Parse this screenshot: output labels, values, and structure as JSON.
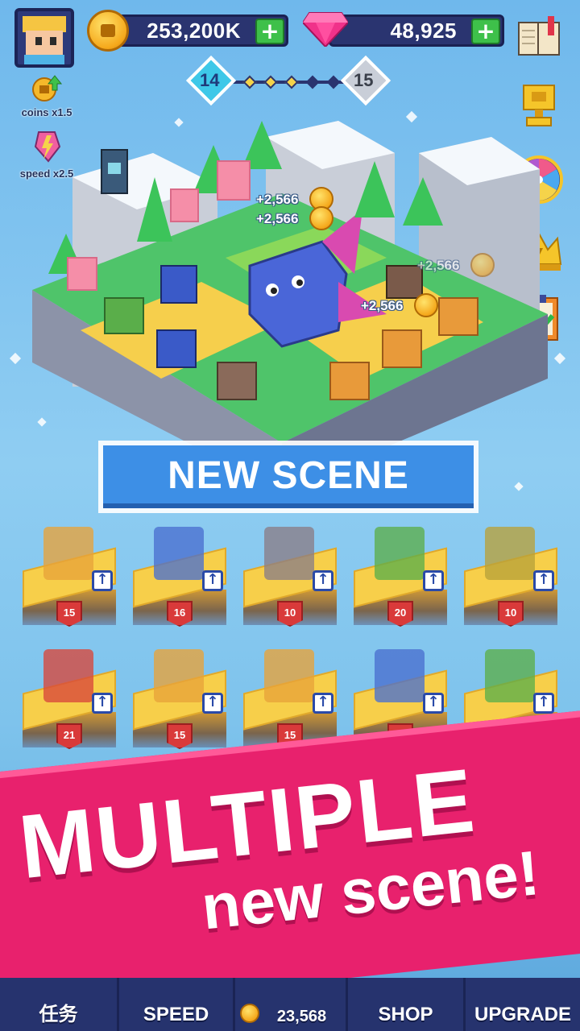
{
  "header": {
    "coins": "253,200K",
    "gems": "48,925",
    "level_current": "14",
    "level_next": "15"
  },
  "boosts": [
    {
      "label": "coins x1.5",
      "icon": "coin-boost-icon"
    },
    {
      "label": "speed x2.5",
      "icon": "speed-boost-icon"
    }
  ],
  "side_buttons": [
    "book-icon",
    "trophy-icon",
    "spin-wheel-icon",
    "crown-icon",
    "clipboard-check-icon"
  ],
  "floating_rewards": [
    "+2,566",
    "+2,566",
    "+2,566",
    "+2,566"
  ],
  "banner": {
    "text": "NEW SCENE"
  },
  "cards": [
    {
      "level": "15",
      "color": "#e8a33a"
    },
    {
      "level": "16",
      "color": "#4a6fd0"
    },
    {
      "level": "10",
      "color": "#8a7d86"
    },
    {
      "level": "20",
      "color": "#5cae4a"
    },
    {
      "level": "10",
      "color": "#b9a13a"
    },
    {
      "level": "21",
      "color": "#d8463b"
    },
    {
      "level": "15",
      "color": "#e8a33a"
    },
    {
      "level": "15",
      "color": "#e8a33a"
    },
    {
      "level": "",
      "color": "#4a6fd0"
    },
    {
      "level": "",
      "color": "#5cae4a"
    }
  ],
  "promo": {
    "title": "MULTIPLE",
    "subtitle": "new scene!"
  },
  "bottom_nav": {
    "tasks": "任务",
    "speed": "SPEED",
    "buy_value": "23,568",
    "shop": "SHOP",
    "upgrade": "UPGRADE"
  },
  "colors": {
    "accent_pink": "#e8216d",
    "navy": "#26336e",
    "banner_blue": "#3d8fe6"
  }
}
